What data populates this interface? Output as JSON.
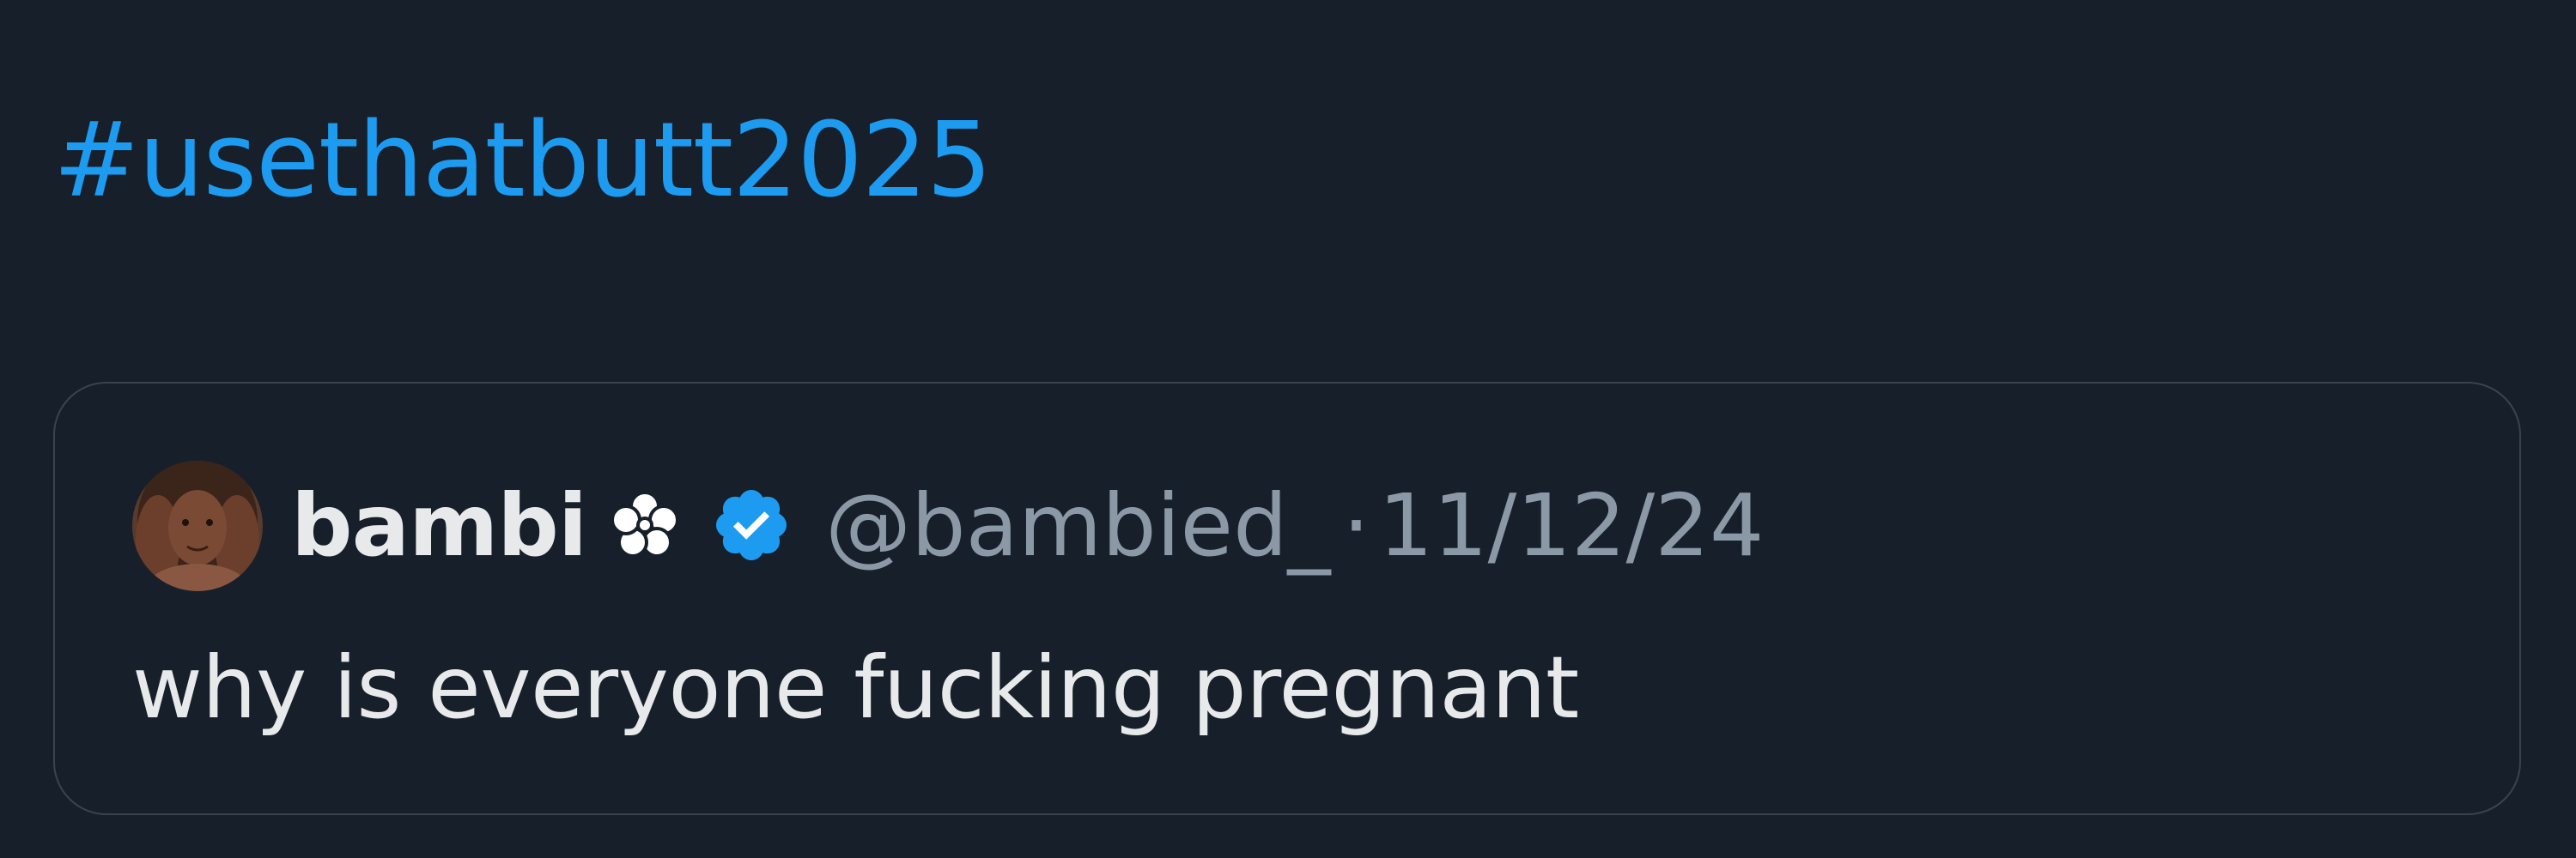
{
  "post": {
    "hashtag": "#usethatbutt2025"
  },
  "quoted_tweet": {
    "display_name": "bambi",
    "name_emoji_icon": "flower-icon",
    "verified_icon": "verified-badge-icon",
    "handle": "@bambied_",
    "separator": "·",
    "date": "11/12/24",
    "text": "why is everyone fucking pregnant"
  },
  "colors": {
    "background": "#17202a",
    "link": "#1d9bf0",
    "primary_text": "#e7e9ea",
    "secondary_text": "#8b98a5",
    "card_border": "#38444d",
    "verified": "#1d9bf0"
  }
}
